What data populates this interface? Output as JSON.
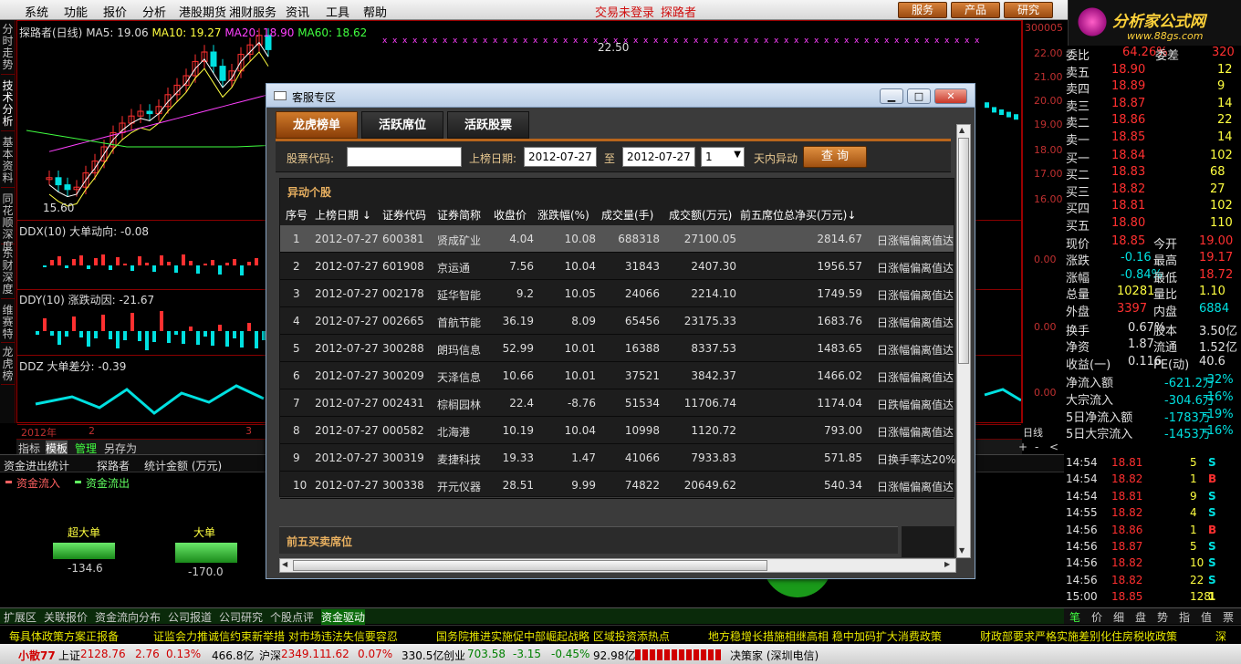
{
  "menu": {
    "items": [
      "系统",
      "功能",
      "报价",
      "分析",
      "港股期货",
      "湘财服务",
      "资讯",
      "工具",
      "帮助"
    ],
    "center": [
      "交易未登录",
      "探路者"
    ],
    "buttons": [
      "服务",
      "产品",
      "研究"
    ]
  },
  "logo": {
    "text": "分析家公式网",
    "url": "www.88gs.com"
  },
  "vtabs": [
    "分时走势",
    "技术分析",
    "基本资料",
    "同花顺深度",
    "东财深度",
    "维赛特",
    "龙虎榜"
  ],
  "chart": {
    "ma_line": {
      "title": "探路者(日线)",
      "ma5": "MA5: 19.06",
      "ma10": "MA10: 19.27",
      "ma20": "MA20: 18.90",
      "ma60": "MA60: 18.62"
    },
    "high_label": "22.50",
    "low_label": "15.60",
    "ddx": "DDX(10) 大单动向: -0.08",
    "ddy": "DDY(10) 涨跌动因: -21.67",
    "ddz": "DDZ 大单差分: -0.39",
    "axis": [
      "22.00",
      "21.00",
      "20.00",
      "19.00",
      "18.00",
      "17.00",
      "16.00",
      "0.00",
      "0.00",
      "0.00"
    ],
    "axis_code": "300005",
    "dates": [
      "2012年",
      "2",
      "3"
    ],
    "period": "日线",
    "zoom": [
      "+",
      "-",
      "<",
      ">"
    ]
  },
  "subtabs": [
    "指标",
    "模板",
    "管理",
    "另存为"
  ],
  "fund": {
    "header": [
      "资金进出统计",
      "探路者",
      "统计金额 (万元)"
    ],
    "legend": [
      "资金流入",
      "资金流出"
    ],
    "bars": [
      {
        "label": "超大单",
        "value": "-134.6"
      },
      {
        "label": "大单",
        "value": "-170.0"
      }
    ]
  },
  "bottom_tabs": [
    "扩展区",
    "关联报价",
    "资金流向分布",
    "公司报道",
    "公司研究",
    "个股点评",
    "资金驱动"
  ],
  "quote": {
    "weibi": [
      "委比",
      "64.26%",
      "委差",
      "320"
    ],
    "sell": [
      [
        "卖五",
        "18.90",
        "12"
      ],
      [
        "卖四",
        "18.89",
        "9"
      ],
      [
        "卖三",
        "18.87",
        "14"
      ],
      [
        "卖二",
        "18.86",
        "22"
      ],
      [
        "卖一",
        "18.85",
        "14"
      ]
    ],
    "buy": [
      [
        "买一",
        "18.84",
        "102"
      ],
      [
        "买二",
        "18.83",
        "68"
      ],
      [
        "买三",
        "18.82",
        "27"
      ],
      [
        "买四",
        "18.81",
        "102"
      ],
      [
        "买五",
        "18.80",
        "110"
      ]
    ],
    "stats": [
      [
        "现价",
        "18.85",
        "今开",
        "19.00"
      ],
      [
        "涨跌",
        "-0.16",
        "最高",
        "19.17"
      ],
      [
        "涨幅",
        "-0.84%",
        "最低",
        "18.72"
      ],
      [
        "总量",
        "10281",
        "量比",
        "1.10"
      ],
      [
        "外盘",
        "3397",
        "内盘",
        "6884"
      ]
    ],
    "stats2": [
      [
        "换手",
        "0.67%",
        "股本",
        "3.50亿"
      ],
      [
        "净资",
        "1.87",
        "流通",
        "1.52亿"
      ],
      [
        "收益(一)",
        "0.116",
        "PE(动)",
        "40.6"
      ]
    ],
    "flow": [
      [
        "净流入额",
        "-621.2万",
        "-32%"
      ],
      [
        "大宗流入",
        "-304.6万",
        "-16%"
      ],
      [
        "5日净流入额",
        "-1783万",
        "-19%"
      ],
      [
        "5日大宗流入",
        "-1453万",
        "-16%"
      ]
    ]
  },
  "ticks": [
    [
      "14:54",
      "18.81",
      "5",
      "S"
    ],
    [
      "14:54",
      "18.82",
      "1",
      "B"
    ],
    [
      "14:54",
      "18.81",
      "9",
      "S"
    ],
    [
      "14:55",
      "18.82",
      "4",
      "S"
    ],
    [
      "14:56",
      "18.86",
      "1",
      "B"
    ],
    [
      "14:56",
      "18.87",
      "5",
      "S"
    ],
    [
      "14:56",
      "18.82",
      "10",
      "S"
    ],
    [
      "14:56",
      "18.82",
      "22",
      "S"
    ],
    [
      "15:00",
      "18.85",
      "128",
      "1"
    ]
  ],
  "right_tabs": [
    "笔",
    "价",
    "细",
    "盘",
    "势",
    "指",
    "值",
    "票"
  ],
  "news": [
    "每具体政策方案正报备",
    "证监会力推诚信约束新举措 对市场违法失信要容忍",
    "国务院推进实施促中部崛起战略 区域投资添热点",
    "地方稳增长措施相继高相 稳中加码扩大消费政策",
    "财政部要求严格实施差别化住房税收政策",
    "深"
  ],
  "status": {
    "a": "小散77",
    "sh_label": "上证",
    "sh": "2128.76",
    "sh_ch": "2.76",
    "sh_pct": "0.13%",
    "sh_amt": "466.8亿",
    "sz_label": "沪深",
    "sz": "2349.11",
    "sz_ch": "1.62",
    "sz_pct": "0.07%",
    "sz_amt": "330.5亿",
    "cy_label": "创业",
    "cy": "703.58",
    "cy_ch": "-3.15",
    "cy_pct": "-0.45%",
    "cy_amt": "92.98亿",
    "broker": "决策家 (深圳电信)"
  },
  "dialog": {
    "title": "客服专区",
    "tabs": [
      "龙虎榜单",
      "活跃席位",
      "活跃股票"
    ],
    "search": {
      "code_label": "股票代码:",
      "code_value": "",
      "date_label": "上榜日期:",
      "from": "2012-07-27",
      "to_label": "至",
      "to": "2012-07-27",
      "days": "1",
      "days_label": "天内异动",
      "btn": "查 询"
    },
    "section": "异动个股",
    "columns": [
      "序号",
      "上榜日期 ↓",
      "证券代码",
      "证券简称",
      "收盘价",
      "涨跌幅(%)",
      "成交量(手)",
      "成交额(万元)",
      "前五席位总净买(万元)↓"
    ],
    "rows": [
      [
        "1",
        "2012-07-27",
        "600381",
        "贤成矿业",
        "4.04",
        "10.08",
        "688318",
        "27100.05",
        "2814.67",
        "日涨幅偏离值达"
      ],
      [
        "2",
        "2012-07-27",
        "601908",
        "京运通",
        "7.56",
        "10.04",
        "31843",
        "2407.30",
        "1956.57",
        "日涨幅偏离值达"
      ],
      [
        "3",
        "2012-07-27",
        "002178",
        "延华智能",
        "9.2",
        "10.05",
        "24066",
        "2214.10",
        "1749.59",
        "日涨幅偏离值达"
      ],
      [
        "4",
        "2012-07-27",
        "002665",
        "首航节能",
        "36.19",
        "8.09",
        "65456",
        "23175.33",
        "1683.76",
        "日涨幅偏离值达"
      ],
      [
        "5",
        "2012-07-27",
        "300288",
        "朗玛信息",
        "52.99",
        "10.01",
        "16388",
        "8337.53",
        "1483.65",
        "日涨幅偏离值达"
      ],
      [
        "6",
        "2012-07-27",
        "300209",
        "天泽信息",
        "10.66",
        "10.01",
        "37521",
        "3842.37",
        "1466.02",
        "日涨幅偏离值达"
      ],
      [
        "7",
        "2012-07-27",
        "002431",
        "棕榈园林",
        "22.4",
        "-8.76",
        "51534",
        "11706.74",
        "1174.04",
        "日跌幅偏离值达"
      ],
      [
        "8",
        "2012-07-27",
        "000582",
        "北海港",
        "10.19",
        "10.04",
        "10998",
        "1120.72",
        "793.00",
        "日涨幅偏离值达"
      ],
      [
        "9",
        "2012-07-27",
        "300319",
        "麦捷科技",
        "19.33",
        "1.47",
        "41066",
        "7933.83",
        "571.85",
        "日换手率达20%"
      ],
      [
        "10",
        "2012-07-27",
        "300338",
        "开元仪器",
        "28.51",
        "9.99",
        "74822",
        "20649.62",
        "540.34",
        "日涨幅偏离值达"
      ]
    ],
    "section2": "前五买卖席位"
  }
}
